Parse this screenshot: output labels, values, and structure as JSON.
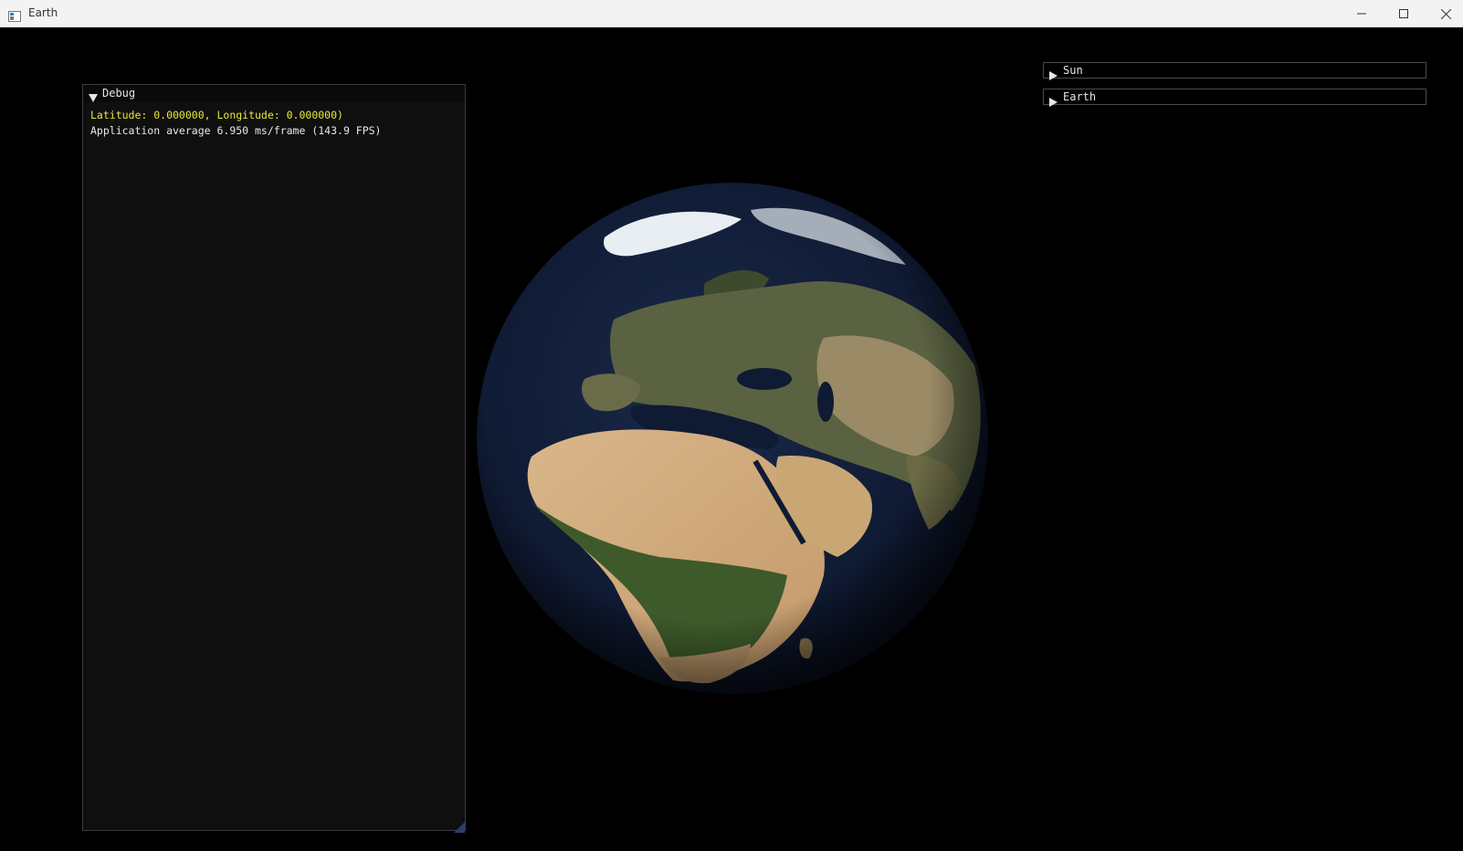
{
  "window": {
    "title": "Earth",
    "controls": [
      "minimize-icon",
      "maximize-icon",
      "close-icon"
    ]
  },
  "debug_panel": {
    "title": "Debug",
    "expanded": true,
    "lines": [
      {
        "text": "Latitude: 0.000000, Longitude: 0.000000)",
        "color": "#e8e83a"
      },
      {
        "text": "Application average 6.950 ms/frame (143.9 FPS)",
        "color": "#e8e8e8"
      }
    ]
  },
  "settings_headers": [
    {
      "label": "Sun",
      "expanded": false
    },
    {
      "label": "Earth",
      "expanded": false
    }
  ],
  "colors": {
    "background": "#000000",
    "panel_bg": "#0f0f0f",
    "panel_border": "#3a3a44",
    "highlight_text": "#e8e83a"
  }
}
